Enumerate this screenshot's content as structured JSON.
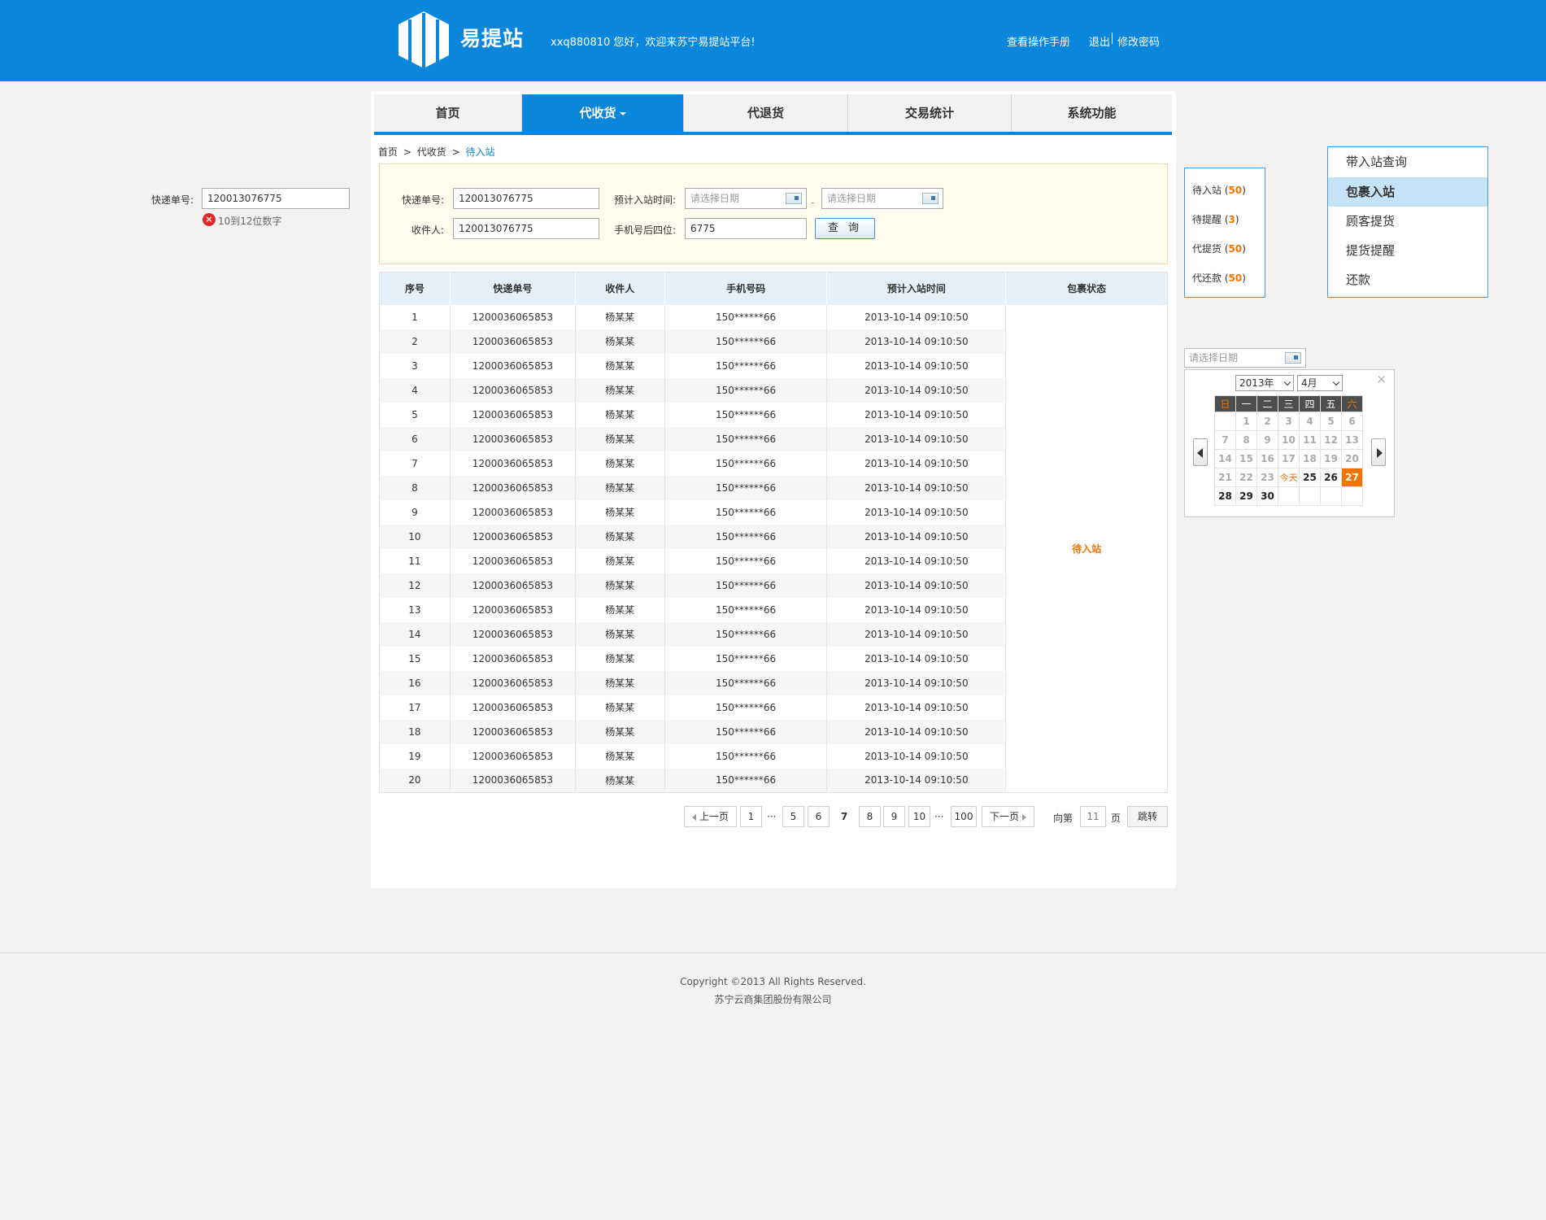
{
  "header": {
    "logo_text": "易提站",
    "welcome": "xxq880810  您好，欢迎来苏宁易提站平台!",
    "manual_link": "查看操作手册",
    "logout_link": "退出",
    "change_pwd_link": "修改密码"
  },
  "nav": {
    "items": [
      {
        "label": "首页"
      },
      {
        "label": "代收货"
      },
      {
        "label": "代退货"
      },
      {
        "label": "交易统计"
      },
      {
        "label": "系统功能"
      }
    ]
  },
  "breadcrumb": {
    "home": "首页",
    "sep1": ">",
    "level2": "代收货",
    "sep2": ">",
    "current": "待入站"
  },
  "search": {
    "tracking_label": "快递单号:",
    "tracking_value": "120013076775",
    "time_label": "预计入站时间:",
    "date_placeholder_start": "请选择日期",
    "date_sep": "-",
    "date_placeholder_end": "请选择日期",
    "recipient_label": "收件人:",
    "recipient_value": "120013076775",
    "phone_label": "手机号后四位:",
    "phone_value": "6775",
    "query_button": "查 询"
  },
  "table": {
    "headers": [
      "序号",
      "快递单号",
      "收件人",
      "手机号码",
      "预计入站时间",
      "包裹状态"
    ],
    "status": "待入站",
    "rows": [
      [
        "1",
        "1200036065853",
        "杨某某",
        "150******66",
        "2013-10-14 09:10:50"
      ],
      [
        "2",
        "1200036065853",
        "杨某某",
        "150******66",
        "2013-10-14 09:10:50"
      ],
      [
        "3",
        "1200036065853",
        "杨某某",
        "150******66",
        "2013-10-14 09:10:50"
      ],
      [
        "4",
        "1200036065853",
        "杨某某",
        "150******66",
        "2013-10-14 09:10:50"
      ],
      [
        "5",
        "1200036065853",
        "杨某某",
        "150******66",
        "2013-10-14 09:10:50"
      ],
      [
        "6",
        "1200036065853",
        "杨某某",
        "150******66",
        "2013-10-14 09:10:50"
      ],
      [
        "7",
        "1200036065853",
        "杨某某",
        "150******66",
        "2013-10-14 09:10:50"
      ],
      [
        "8",
        "1200036065853",
        "杨某某",
        "150******66",
        "2013-10-14 09:10:50"
      ],
      [
        "9",
        "1200036065853",
        "杨某某",
        "150******66",
        "2013-10-14 09:10:50"
      ],
      [
        "10",
        "1200036065853",
        "杨某某",
        "150******66",
        "2013-10-14 09:10:50"
      ],
      [
        "11",
        "1200036065853",
        "杨某某",
        "150******66",
        "2013-10-14 09:10:50"
      ],
      [
        "12",
        "1200036065853",
        "杨某某",
        "150******66",
        "2013-10-14 09:10:50"
      ],
      [
        "13",
        "1200036065853",
        "杨某某",
        "150******66",
        "2013-10-14 09:10:50"
      ],
      [
        "14",
        "1200036065853",
        "杨某某",
        "150******66",
        "2013-10-14 09:10:50"
      ],
      [
        "15",
        "1200036065853",
        "杨某某",
        "150******66",
        "2013-10-14 09:10:50"
      ],
      [
        "16",
        "1200036065853",
        "杨某某",
        "150******66",
        "2013-10-14 09:10:50"
      ],
      [
        "17",
        "1200036065853",
        "杨某某",
        "150******66",
        "2013-10-14 09:10:50"
      ],
      [
        "18",
        "1200036065853",
        "杨某某",
        "150******66",
        "2013-10-14 09:10:50"
      ],
      [
        "19",
        "1200036065853",
        "杨某某",
        "150******66",
        "2013-10-14 09:10:50"
      ],
      [
        "20",
        "1200036065853",
        "杨某某",
        "150******66",
        "2013-10-14 09:10:50"
      ]
    ]
  },
  "pagination": {
    "prev": "上一页",
    "next": "下一页",
    "pages": [
      "1",
      "5",
      "6",
      "7",
      "8",
      "9",
      "10",
      "100"
    ],
    "ellipsis": "···",
    "current": "7",
    "goto_prefix": "向第",
    "goto_value": "11",
    "goto_suffix": "页",
    "goto_button": "跳转"
  },
  "validation": {
    "label": "快递单号:",
    "value": "120013076775",
    "error": "10到12位数字"
  },
  "status_box": {
    "items": [
      {
        "label": "待入站",
        "count": "50"
      },
      {
        "label": "待提醒",
        "count": "3"
      },
      {
        "label": "代提货",
        "count": "50"
      },
      {
        "label": "代还款",
        "count": "50"
      }
    ]
  },
  "side_menu": {
    "items": [
      "带入站查询",
      "包裹入站",
      "顾客提货",
      "提货提醒",
      "还款"
    ],
    "selected": "包裹入站"
  },
  "datepicker": {
    "placeholder": "请选择日期",
    "year": "2013年",
    "month": "4月",
    "close": "×",
    "weekdays": [
      "日",
      "一",
      "二",
      "三",
      "四",
      "五",
      "六"
    ],
    "today_label": "今天",
    "weeks": [
      [
        "",
        "1",
        "2",
        "3",
        "4",
        "5",
        "6"
      ],
      [
        "7",
        "8",
        "9",
        "10",
        "11",
        "12",
        "13"
      ],
      [
        "14",
        "15",
        "16",
        "17",
        "18",
        "19",
        "20"
      ],
      [
        "21",
        "22",
        "23",
        "今天",
        "25",
        "26",
        "27"
      ],
      [
        "28",
        "29",
        "30",
        "",
        "",
        "",
        ""
      ]
    ]
  },
  "footer": {
    "copyright": "Copyright ©2013 All Rights Reserved.",
    "company": "苏宁云商集团股份有限公司"
  },
  "colors": {
    "brand_blue": "#0a86dd",
    "accent_orange": "#f27403",
    "search_bg": "#fffded",
    "table_header_bg": "#e4f1fb"
  }
}
